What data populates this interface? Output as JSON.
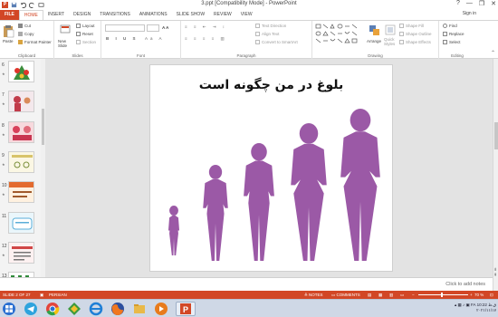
{
  "window": {
    "title": "3.ppt [Compatibility Mode] - PowerPoint",
    "controls": [
      "?",
      "—",
      "❐",
      "✕"
    ]
  },
  "tabs": [
    "FILE",
    "HOME",
    "INSERT",
    "DESIGN",
    "TRANSITIONS",
    "ANIMATIONS",
    "SLIDE SHOW",
    "REVIEW",
    "VIEW"
  ],
  "active_tab": "HOME",
  "signin": "Sign in",
  "ribbon": {
    "clipboard": {
      "label": "Clipboard",
      "paste": "Paste",
      "cut": "Cut",
      "copy": "Copy",
      "format_painter": "Format Painter"
    },
    "slides": {
      "label": "Slides",
      "new_slide": "New Slide",
      "layout": "Layout",
      "reset": "Reset",
      "section": "Section"
    },
    "font": {
      "label": "Font"
    },
    "paragraph": {
      "label": "Paragraph",
      "text_direction": "Text Direction",
      "align_text": "Align Text",
      "convert": "Convert to SmartArt"
    },
    "drawing": {
      "label": "Drawing",
      "arrange": "Arrange",
      "quick_styles": "Quick Styles",
      "shape_fill": "Shape Fill",
      "shape_outline": "Shape Outline",
      "shape_effects": "Shape Effects"
    },
    "editing": {
      "label": "Editing",
      "find": "Find",
      "replace": "Replace",
      "select": "Select"
    }
  },
  "thumbnails": [
    {
      "num": "6"
    },
    {
      "num": "7"
    },
    {
      "num": "8"
    },
    {
      "num": "9"
    },
    {
      "num": "10"
    },
    {
      "num": "11"
    },
    {
      "num": "12"
    },
    {
      "num": "13"
    }
  ],
  "slide": {
    "title": "بلوغ در من چگونه است",
    "silhouette_color": "#9b59a6"
  },
  "notes_placeholder": "Click to add notes",
  "status": {
    "slide_of": "SLIDE 2 OF 27",
    "language": "PERSIAN",
    "notes": "NOTES",
    "comments": "COMMENTS",
    "zoom": "70 %"
  },
  "taskbar": {
    "lang": "FA",
    "time": "10:22 ق.ظ",
    "date": "۲۰۲۱/۱۱/۱۷"
  }
}
